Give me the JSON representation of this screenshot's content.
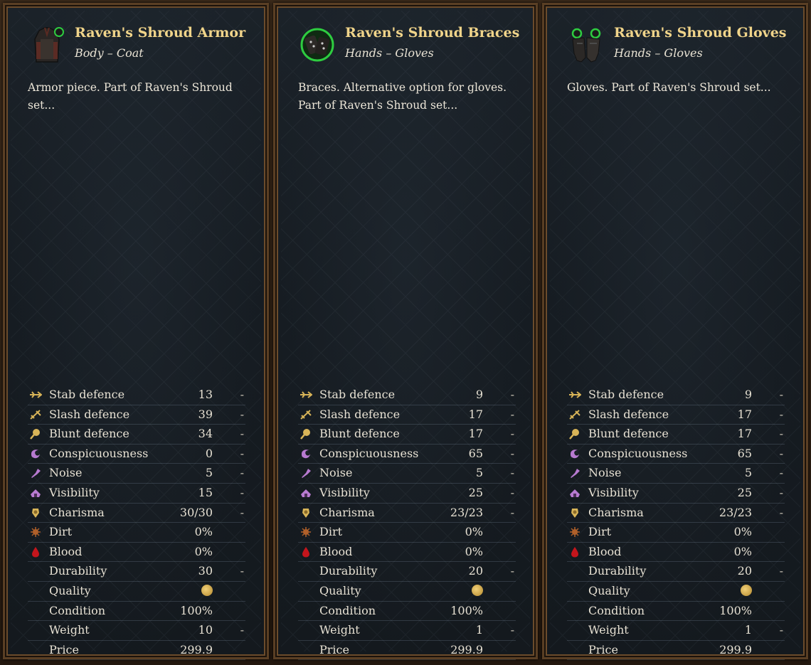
{
  "items": [
    {
      "title": "Raven's Shroud Armor",
      "subtitle": "Body – Coat",
      "description": "Armor piece. Part of Raven's Shroud set...",
      "icon": "coat-icon",
      "stats": [
        {
          "icon": "stab-icon",
          "label": "Stab defence",
          "value": "13",
          "dash": "-"
        },
        {
          "icon": "slash-icon",
          "label": "Slash defence",
          "value": "39",
          "dash": "-"
        },
        {
          "icon": "blunt-icon",
          "label": "Blunt defence",
          "value": "34",
          "dash": "-"
        },
        {
          "icon": "conspicuousness-icon",
          "label": "Conspicuousness",
          "value": "0",
          "dash": "-"
        },
        {
          "icon": "noise-icon",
          "label": "Noise",
          "value": "5",
          "dash": "-"
        },
        {
          "icon": "visibility-icon",
          "label": "Visibility",
          "value": "15",
          "dash": "-"
        },
        {
          "icon": "charisma-icon",
          "label": "Charisma",
          "value": "30/30",
          "dash": "-"
        },
        {
          "icon": "dirt-icon",
          "label": "Dirt",
          "value": "0%",
          "dash": ""
        },
        {
          "icon": "blood-icon",
          "label": "Blood",
          "value": "0%",
          "dash": ""
        },
        {
          "icon": "",
          "label": "Durability",
          "value": "30",
          "dash": "-"
        },
        {
          "icon": "",
          "label": "Quality",
          "value": "",
          "dash": "",
          "coin": true
        },
        {
          "icon": "",
          "label": "Condition",
          "value": "100%",
          "dash": ""
        },
        {
          "icon": "",
          "label": "Weight",
          "value": "10",
          "dash": "-"
        },
        {
          "icon": "",
          "label": "Price",
          "value": "299.9",
          "dash": ""
        }
      ]
    },
    {
      "title": "Raven's Shroud Braces",
      "subtitle": "Hands – Gloves",
      "description": "Braces. Alternative option for gloves. Part of Raven's Shroud set...",
      "icon": "braces-icon",
      "stats": [
        {
          "icon": "stab-icon",
          "label": "Stab defence",
          "value": "9",
          "dash": "-"
        },
        {
          "icon": "slash-icon",
          "label": "Slash defence",
          "value": "17",
          "dash": "-"
        },
        {
          "icon": "blunt-icon",
          "label": "Blunt defence",
          "value": "17",
          "dash": "-"
        },
        {
          "icon": "conspicuousness-icon",
          "label": "Conspicuousness",
          "value": "65",
          "dash": "-"
        },
        {
          "icon": "noise-icon",
          "label": "Noise",
          "value": "5",
          "dash": "-"
        },
        {
          "icon": "visibility-icon",
          "label": "Visibility",
          "value": "25",
          "dash": "-"
        },
        {
          "icon": "charisma-icon",
          "label": "Charisma",
          "value": "23/23",
          "dash": "-"
        },
        {
          "icon": "dirt-icon",
          "label": "Dirt",
          "value": "0%",
          "dash": ""
        },
        {
          "icon": "blood-icon",
          "label": "Blood",
          "value": "0%",
          "dash": ""
        },
        {
          "icon": "",
          "label": "Durability",
          "value": "20",
          "dash": "-"
        },
        {
          "icon": "",
          "label": "Quality",
          "value": "",
          "dash": "",
          "coin": true
        },
        {
          "icon": "",
          "label": "Condition",
          "value": "100%",
          "dash": ""
        },
        {
          "icon": "",
          "label": "Weight",
          "value": "1",
          "dash": "-"
        },
        {
          "icon": "",
          "label": "Price",
          "value": "299.9",
          "dash": ""
        }
      ]
    },
    {
      "title": "Raven's Shroud Gloves",
      "subtitle": "Hands – Gloves",
      "description": "Gloves. Part of Raven's Shroud set...",
      "icon": "gloves-icon",
      "stats": [
        {
          "icon": "stab-icon",
          "label": "Stab defence",
          "value": "9",
          "dash": "-"
        },
        {
          "icon": "slash-icon",
          "label": "Slash defence",
          "value": "17",
          "dash": "-"
        },
        {
          "icon": "blunt-icon",
          "label": "Blunt defence",
          "value": "17",
          "dash": "-"
        },
        {
          "icon": "conspicuousness-icon",
          "label": "Conspicuousness",
          "value": "65",
          "dash": "-"
        },
        {
          "icon": "noise-icon",
          "label": "Noise",
          "value": "5",
          "dash": "-"
        },
        {
          "icon": "visibility-icon",
          "label": "Visibility",
          "value": "25",
          "dash": "-"
        },
        {
          "icon": "charisma-icon",
          "label": "Charisma",
          "value": "23/23",
          "dash": "-"
        },
        {
          "icon": "dirt-icon",
          "label": "Dirt",
          "value": "0%",
          "dash": ""
        },
        {
          "icon": "blood-icon",
          "label": "Blood",
          "value": "0%",
          "dash": ""
        },
        {
          "icon": "",
          "label": "Durability",
          "value": "20",
          "dash": "-"
        },
        {
          "icon": "",
          "label": "Quality",
          "value": "",
          "dash": "",
          "coin": true
        },
        {
          "icon": "",
          "label": "Condition",
          "value": "100%",
          "dash": ""
        },
        {
          "icon": "",
          "label": "Weight",
          "value": "1",
          "dash": "-"
        },
        {
          "icon": "",
          "label": "Price",
          "value": "299.9",
          "dash": ""
        }
      ]
    }
  ],
  "colors": {
    "title": "#f0d48a",
    "text": "#e7e1d3",
    "panel": "#171d23",
    "frame": "#5a3f24",
    "set-gem": "#2ecc40"
  }
}
